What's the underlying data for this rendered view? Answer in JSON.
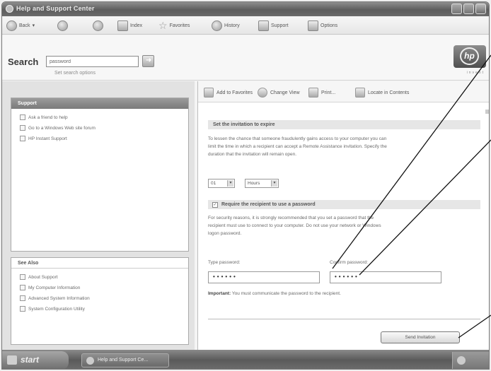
{
  "window": {
    "title": "Help and Support Center"
  },
  "toolbar": {
    "back": "Back",
    "index": "Index",
    "favorites": "Favorites",
    "history": "History",
    "support": "Support",
    "options": "Options"
  },
  "search": {
    "label": "Search",
    "value": "password",
    "options_link": "Set search options"
  },
  "brand": {
    "logo": "hp",
    "tagline": "invent"
  },
  "left": {
    "support": {
      "title": "Support",
      "items": [
        "Ask a friend to help",
        "Go to a Windows Web site forum",
        "HP Instant Support"
      ]
    },
    "see_also": {
      "title": "See Also",
      "items": [
        "About Support",
        "My Computer Information",
        "Advanced System Information",
        "System Configuration Utility"
      ]
    }
  },
  "right_toolbar": {
    "add_favorites": "Add to Favorites",
    "change_view": "Change View",
    "print": "Print...",
    "locate": "Locate in Contents"
  },
  "invitation": {
    "heading": "Set the invitation to expire",
    "text_line1": "To lessen the chance that someone fraudulently gains access to your computer you can",
    "text_line2": "limit the time in which a recipient can accept a Remote Assistance invitation. Specify the",
    "text_line3": "duration that the invitation will remain open.",
    "duration_value": "01",
    "duration_unit": "Hours",
    "require_password": "Require the recipient to use a password",
    "require_checked": "✓",
    "security_line1": "For security reasons, it is strongly recommended that you set a password that the",
    "security_line2": "recipient must use to connect to your computer. Do not use your network or Windows",
    "security_line3": "logon password.",
    "type_password_label": "Type password:",
    "confirm_password_label": "Confirm password:",
    "type_password_value": "••••••",
    "confirm_password_value": "••••••",
    "important_label": "Important:",
    "important_text": "You must communicate the password to the recipient.",
    "send_button": "Send Invitation"
  },
  "taskbar": {
    "start": "start",
    "task": "Help and Support Ce..."
  }
}
